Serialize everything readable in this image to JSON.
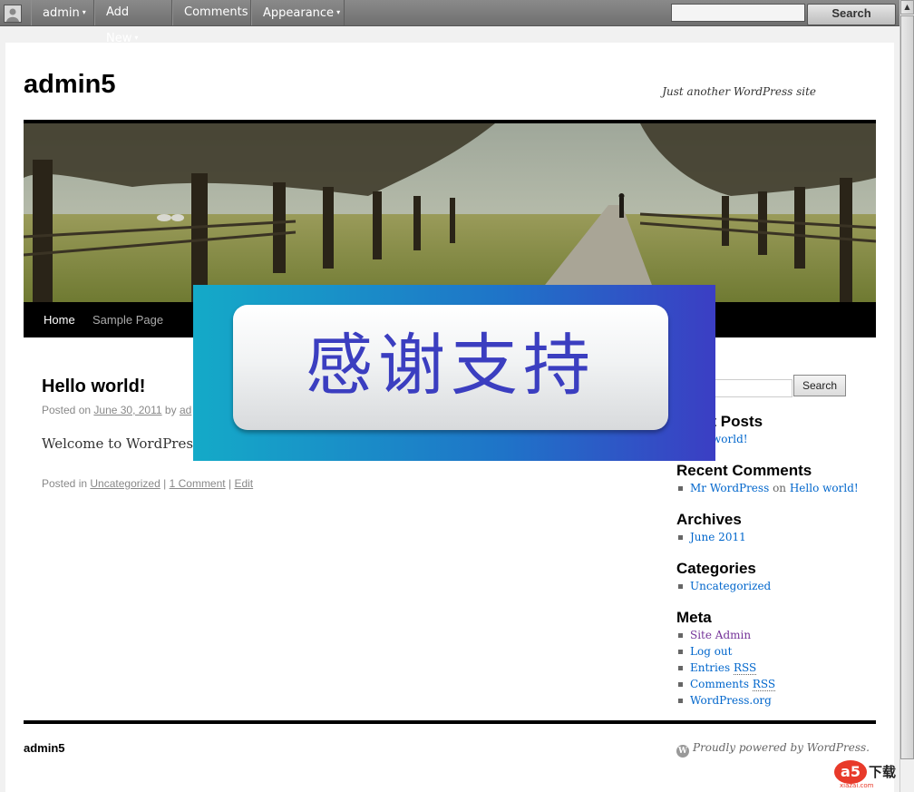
{
  "adminbar": {
    "items": [
      {
        "label": "admin",
        "caret": "▾"
      },
      {
        "label": "Add New",
        "caret": "▾"
      },
      {
        "label": "Comments",
        "caret": ""
      },
      {
        "label": "Appearance",
        "caret": "▾"
      }
    ],
    "search_value": "",
    "search_button": "Search"
  },
  "site": {
    "title": "admin5",
    "description": "Just another WordPress site"
  },
  "nav": {
    "items": [
      {
        "label": "Home"
      },
      {
        "label": "Sample Page"
      }
    ]
  },
  "post": {
    "title": "Hello world!",
    "meta_prefix": "Posted on",
    "date": "June 30, 2011",
    "meta_by": "by",
    "author_visible": "ad",
    "content": "Welcome to WordPress.",
    "posted_in": "Posted in",
    "category": "Uncategorized",
    "comments": "1 Comment",
    "edit": "Edit",
    "sep": "|"
  },
  "sidebar": {
    "search_value": "",
    "search_button": "Search",
    "recent_posts_title_visible": "nt Posts",
    "recent_post_visible": "o world!",
    "recent_comments_title": "Recent Comments",
    "recent_comment": {
      "author": "Mr WordPress",
      "on": "on",
      "post": "Hello world!"
    },
    "archives_title": "Archives",
    "archives": [
      "June 2011"
    ],
    "categories_title": "Categories",
    "categories": [
      "Uncategorized"
    ],
    "meta_title": "Meta",
    "meta_links": [
      "Site Admin",
      "Log out",
      "Entries",
      "Comments",
      "WordPress.org"
    ],
    "rss": "RSS"
  },
  "footer": {
    "site_title": "admin5",
    "powered": "Proudly powered by WordPress."
  },
  "overlay": {
    "text": "感谢支持"
  },
  "watermark": {
    "logo": "a5",
    "text": "下载",
    "small": "xiazai.com"
  }
}
